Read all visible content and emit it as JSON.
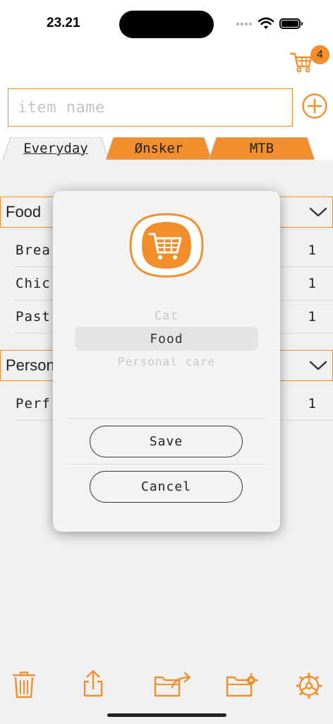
{
  "status_bar": {
    "time": "23.21"
  },
  "header": {
    "cart_count": "4"
  },
  "input": {
    "placeholder": "item name"
  },
  "tabs": [
    {
      "label": "Everyday",
      "active": true
    },
    {
      "label": "Ønsker",
      "active": false
    },
    {
      "label": "MTB",
      "active": false
    }
  ],
  "sections": [
    {
      "title": "Food",
      "items": [
        {
          "name": "Brea",
          "qty": "1"
        },
        {
          "name": "Chic",
          "qty": "1"
        },
        {
          "name": "Past",
          "qty": "1"
        }
      ]
    },
    {
      "title": "Person",
      "items": [
        {
          "name": "Perf",
          "qty": "1"
        }
      ]
    }
  ],
  "modal": {
    "picker_options": [
      "Cat",
      "Food",
      "Personal care"
    ],
    "selected": "Food",
    "save_label": "Save",
    "cancel_label": "Cancel"
  },
  "toolbar_icons": [
    "trash-icon",
    "share-icon",
    "folder-export-icon",
    "folder-settings-icon",
    "settings-icon"
  ],
  "colors": {
    "accent": "#f28f2c",
    "background": "#f1f1f1"
  }
}
